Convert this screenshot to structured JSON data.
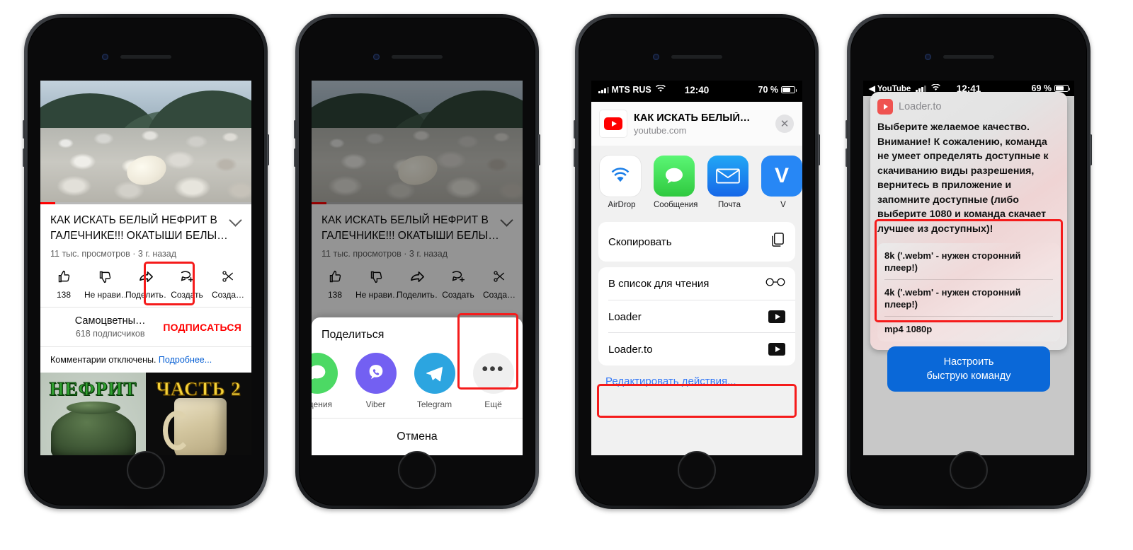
{
  "phones": {
    "one": {
      "video": {
        "title": "КАК ИСКАТЬ БЕЛЫЙ НЕФРИТ В ГАЛЕЧНИКЕ!!! ОКАТЫШИ БЕЛЫ…",
        "meta": "11 тыс. просмотров · 3 г. назад"
      },
      "actions": [
        {
          "label": "138",
          "icon": "thumbs-up-icon"
        },
        {
          "label": "Не нрави…",
          "icon": "thumbs-down-icon"
        },
        {
          "label": "Поделить…",
          "icon": "share-arrow-icon"
        },
        {
          "label": "Создать",
          "icon": "create-clip-icon"
        },
        {
          "label": "Созда…",
          "icon": "scissors-icon"
        }
      ],
      "channel": {
        "name": "Самоцветны…",
        "subs": "618 подписчиков",
        "subscribe": "ПОДПИСАТЬСЯ"
      },
      "comments": {
        "text": "Комментарии отключены.",
        "link": "Подробнее..."
      },
      "thumbs": [
        {
          "text": "НЕФРИТ"
        },
        {
          "text": "ЧАСТЬ 2"
        }
      ]
    },
    "two": {
      "share_title": "Поделиться",
      "apps": [
        {
          "label": "бщения",
          "icon": "messages-icon",
          "color": "#4cd964"
        },
        {
          "label": "Viber",
          "icon": "viber-icon",
          "color": "#7360f2"
        },
        {
          "label": "Telegram",
          "icon": "telegram-icon",
          "color": "#2ca5e0"
        },
        {
          "label": "Ещё",
          "icon": "more-dots-icon",
          "color": "#efefef"
        }
      ],
      "cancel": "Отмена"
    },
    "three": {
      "status": {
        "carrier": "MTS RUS",
        "time": "12:40",
        "battery": "70 %"
      },
      "header": {
        "title": "КАК ИСКАТЬ БЕЛЫЙ…",
        "domain": "youtube.com",
        "close": "✕"
      },
      "apps": [
        {
          "label": "AirDrop",
          "icon": "airdrop-icon"
        },
        {
          "label": "Сообщения",
          "icon": "messages-icon"
        },
        {
          "label": "Почта",
          "icon": "mail-icon"
        },
        {
          "label": "V",
          "icon": "vk-icon"
        }
      ],
      "actions_group_1": [
        {
          "label": "Скопировать",
          "icon": "copy-icon"
        }
      ],
      "actions_group_2": [
        {
          "label": "В список для чтения",
          "icon": "glasses-icon"
        },
        {
          "label": "Loader",
          "icon": "shortcut-play-icon"
        },
        {
          "label": "Loader.to",
          "icon": "shortcut-play-icon"
        }
      ],
      "edit_actions": "Редактировать действия..."
    },
    "four": {
      "status": {
        "back_app": "◀ YouTube",
        "time": "12:41",
        "battery": "69 %"
      },
      "app_name": "Loader.to",
      "message": "Выберите желаемое качество. Внимание! К сожалению, команда не умеет определять доступные к скачиванию виды разрешения, вернитесь в приложение и запомните доступные (либо выберите 1080 и команда скачает лучшее из доступных)!",
      "options": [
        "8k ('.webm' - нужен сторонний плеер!)",
        "4k ('.webm' - нужен сторонний плеер!)",
        "mp4 1080p"
      ],
      "button": "Настроить\nбыструю команду"
    }
  },
  "colors": {
    "highlight": "#f51b1b",
    "youtube_red": "#ff0000",
    "ios_blue": "#3478f6",
    "shortcut_blue": "#0a68d8"
  }
}
